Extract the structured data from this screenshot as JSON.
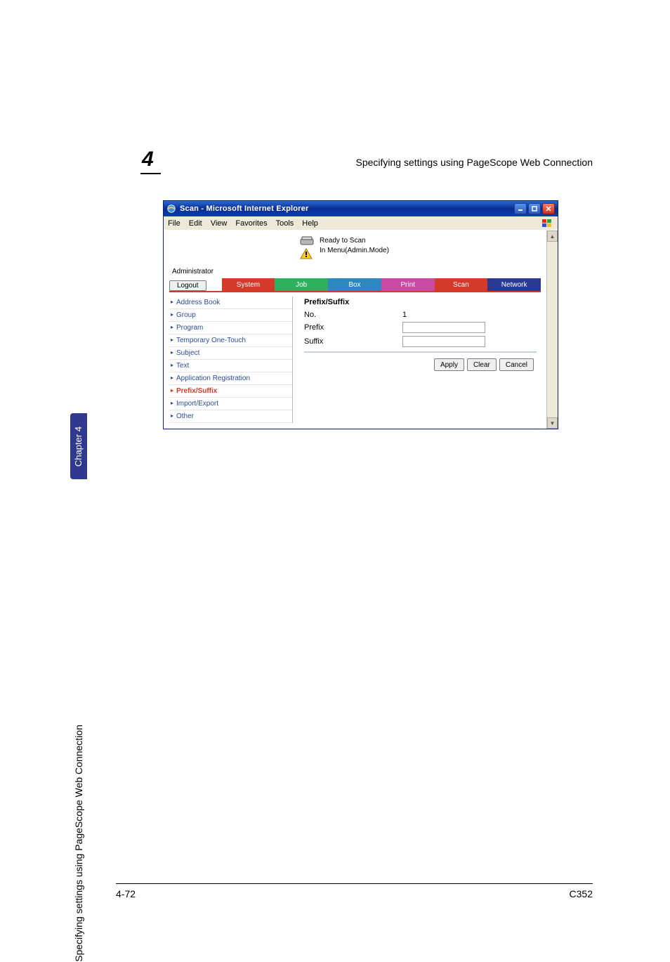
{
  "page": {
    "chapter_number": "4",
    "header_title": "Specifying settings using PageScope Web Connection",
    "side_tab": "Chapter 4",
    "side_text": "Specifying settings using PageScope Web Connection",
    "footer_left": "4-72",
    "footer_right": "C352"
  },
  "browser": {
    "title": "Scan - Microsoft Internet Explorer",
    "menus": {
      "file": "File",
      "edit": "Edit",
      "view": "View",
      "favorites": "Favorites",
      "tools": "Tools",
      "help": "Help"
    },
    "status": {
      "ready": "Ready to Scan",
      "admin_mode": "In Menu(Admin.Mode)"
    },
    "admin_label": "Administrator",
    "logout": "Logout",
    "tabs": {
      "system": "System",
      "job": "Job",
      "box": "Box",
      "print": "Print",
      "scan": "Scan",
      "network": "Network"
    },
    "sidebar": {
      "address_book": "Address Book",
      "group": "Group",
      "program": "Program",
      "temp_one_touch": "Temporary One-Touch",
      "subject": "Subject",
      "text": "Text",
      "app_reg": "Application Registration",
      "prefix_suffix": "Prefix/Suffix",
      "import_export": "Import/Export",
      "other": "Other"
    },
    "panel": {
      "title": "Prefix/Suffix",
      "no_label": "No.",
      "no_value": "1",
      "prefix_label": "Prefix",
      "prefix_value": "",
      "suffix_label": "Suffix",
      "suffix_value": ""
    },
    "buttons": {
      "apply": "Apply",
      "clear": "Clear",
      "cancel": "Cancel"
    }
  }
}
